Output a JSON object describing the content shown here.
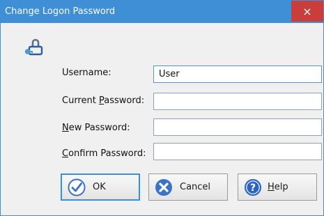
{
  "window": {
    "title": "Change Logon Password",
    "close_glyph": "×"
  },
  "icons": {
    "key": "key-lock-icon",
    "ok": "check-circle-icon",
    "cancel": "x-circle-icon",
    "help": "question-circle-icon"
  },
  "form": {
    "username": {
      "label": "Username:",
      "value": "User"
    },
    "current_password": {
      "label_before": "Current ",
      "label_accel": "P",
      "label_after": "assword:",
      "value": ""
    },
    "new_password": {
      "label_before": "",
      "label_accel": "N",
      "label_after": "ew Password:",
      "value": ""
    },
    "confirm_password": {
      "label_before": "",
      "label_accel": "C",
      "label_after": "onfirm Password:",
      "value": ""
    }
  },
  "buttons": {
    "ok": "OK",
    "cancel": "Cancel",
    "help_accel": "H",
    "help_rest": "elp"
  },
  "colors": {
    "title_bar": "#3f8fd6",
    "close_button": "#c93d3a",
    "ok_icon": "#3c73c7",
    "cancel_icon": "#3c73c7",
    "help_icon": "#2b63c3"
  }
}
